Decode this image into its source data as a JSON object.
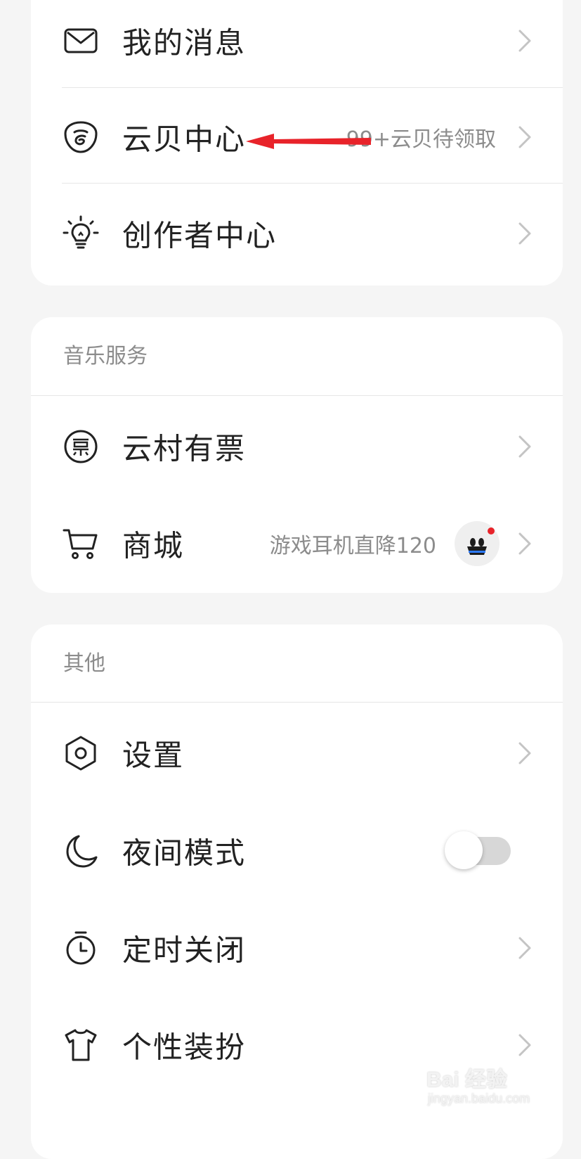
{
  "account_section": {
    "items": [
      {
        "icon": "mail-icon",
        "label": "我的消息",
        "hint": ""
      },
      {
        "icon": "yunbei-icon",
        "label": "云贝中心",
        "hint": "99+云贝待领取"
      },
      {
        "icon": "lightbulb-icon",
        "label": "创作者中心",
        "hint": ""
      }
    ]
  },
  "music_section": {
    "title": "音乐服务",
    "items": [
      {
        "icon": "ticket-icon",
        "label": "云村有票",
        "hint": ""
      },
      {
        "icon": "cart-icon",
        "label": "商城",
        "hint": "游戏耳机直降120"
      }
    ]
  },
  "other_section": {
    "title": "其他",
    "items": [
      {
        "icon": "settings-hexagon-icon",
        "label": "设置",
        "hint": ""
      },
      {
        "icon": "moon-icon",
        "label": "夜间模式",
        "hint": "",
        "toggle": "off"
      },
      {
        "icon": "timer-icon",
        "label": "定时关闭",
        "hint": ""
      },
      {
        "icon": "tshirt-icon",
        "label": "个性装扮",
        "hint": ""
      }
    ]
  },
  "annotation": {
    "arrow_color": "#e8232a"
  },
  "watermark": {
    "logo_text": "Bai 经验",
    "url": "jingyan.baidu.com"
  },
  "colors": {
    "background": "#f5f5f5",
    "card": "#ffffff",
    "text": "#222222",
    "hint": "#8c8c8c"
  }
}
